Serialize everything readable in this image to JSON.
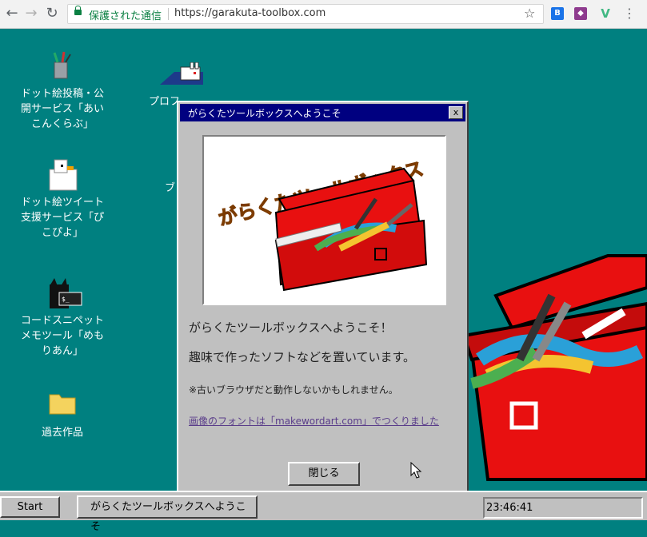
{
  "browser": {
    "secure_label": "保護された通信",
    "url": "https://garakuta-toolbox.com"
  },
  "desktop": {
    "icons": [
      {
        "label_lines": [
          "ドット絵投稿・公",
          "開サービス「あい",
          "こんくらぶ」"
        ],
        "icon": "pencil-cup-icon"
      },
      {
        "label_lines": [
          "ドット絵ツイート",
          "支援サービス「ぴ",
          "こぴよ」"
        ],
        "icon": "duck-icon"
      },
      {
        "label_lines": [
          "コードスニペット",
          "メモツール「めも",
          "りあん」"
        ],
        "icon": "cat-terminal-icon"
      },
      {
        "label_lines": [
          "過去作品"
        ],
        "icon": "folder-icon"
      }
    ],
    "partial_icons": [
      {
        "label": "プロフ",
        "icon": "rabbit-icon"
      },
      {
        "label": "ブ",
        "icon": "blog-icon"
      }
    ]
  },
  "dialog": {
    "title": "がらくたツールボックスへようこそ",
    "logo_text": "がらくたツールボックス",
    "heading": "がらくたツールボックスへようこそ！",
    "body": "趣味で作ったソフトなどを置いています。",
    "note": "※古いブラウザだと動作しないかもしれません。",
    "link": "画像のフォントは「makewordart.com」でつくりました",
    "close_button": "閉じる",
    "close_x": "x"
  },
  "taskbar": {
    "start": "Start",
    "task": "がらくたツールボックスへようこそ",
    "clock": "23:46:41"
  },
  "colors": {
    "desktop": "#008080",
    "titlebar": "#000080",
    "toolbox_red": "#e81010"
  }
}
